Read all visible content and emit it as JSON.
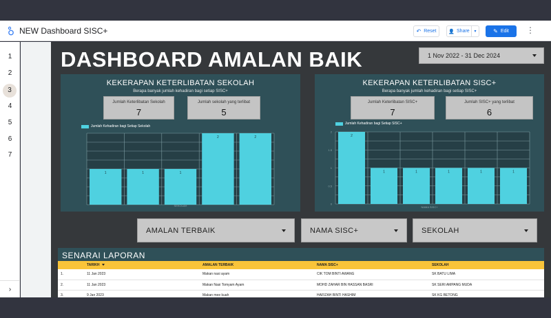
{
  "app": {
    "title": "NEW Dashboard SISC+",
    "reset_label": "Reset",
    "share_label": "Share",
    "edit_label": "Edit"
  },
  "pages": [
    "1",
    "2",
    "3",
    "4",
    "5",
    "6",
    "7"
  ],
  "active_page": "3",
  "dashboard": {
    "title": "DASHBOARD AMALAN BAIK",
    "date_range": "1 Nov 2022 - 31 Dec 2024"
  },
  "panel_left": {
    "title": "KEKERAPAN KETERLIBATAN SEKOLAH",
    "subtitle": "Berapa banyak jumlah kehadiran bagi setiap SISC+",
    "kpi1_label": "Jumlah Keterlibatan Sekolah",
    "kpi1_value": "7",
    "kpi2_label": "Jumlah sekolah yang terlibat",
    "kpi2_value": "5",
    "legend": "Jumlah Kehadiran bagi Setiap Sekolah",
    "xlabel": "SEKOLAH"
  },
  "panel_right": {
    "title": "KEKERAPAN KETERLIBATAN SISC+",
    "subtitle": "Berapa banyak jumlah kehadiran bagi setiap SISC+",
    "kpi1_label": "Jumlah Keterlibatan SISC+",
    "kpi1_value": "7",
    "kpi2_label": "Jumlah SISC+ yang terlibat",
    "kpi2_value": "6",
    "legend": "Jumlah Kehadiran bagi Setiap SISC+",
    "xlabel": "NAMA SISC+"
  },
  "filters": {
    "amalan": "AMALAN TERBAIK",
    "nama": "NAMA SISC+",
    "sekolah": "SEKOLAH"
  },
  "report": {
    "title": "SENARAI LAPORAN",
    "columns": [
      "TARIKH",
      "AMALAN TERBAIK",
      "NAMA SISC+",
      "SEKOLAH"
    ],
    "rows": [
      {
        "no": "1.",
        "tarikh": "11 Jan 2023",
        "amalan": "Makan nasi ayam",
        "nama": "CIK TOM BINTI AWANG",
        "sekolah": "SK BATU LIMA"
      },
      {
        "no": "2.",
        "tarikh": "11 Jan 2023",
        "amalan": "Makan Nasi Tomyam Ayam",
        "nama": "MOHD ZAHAR BIN HASSAN BASRI",
        "sekolah": "SK SERI AMPANG MUDA"
      },
      {
        "no": "3.",
        "tarikh": "9 Jan 2023",
        "amalan": "Makan mee kuah",
        "nama": "HAFIZAH BINTI HASHIM",
        "sekolah": "SK KG BETONG"
      }
    ]
  },
  "chart_data": [
    {
      "type": "bar",
      "title": "KEKERAPAN KETERLIBATAN SEKOLAH",
      "xlabel": "SEKOLAH",
      "series": [
        {
          "name": "Jumlah Kehadiran bagi Setiap Sekolah",
          "values": [
            1,
            1,
            1,
            2,
            2
          ]
        }
      ],
      "data_labels": [
        "1",
        "1",
        "1",
        "2",
        "2"
      ],
      "color": "#4fd1e0",
      "ylim": [
        0,
        2
      ],
      "grid": true,
      "legend": "top-left"
    },
    {
      "type": "bar",
      "title": "KEKERAPAN KETERLIBATAN SISC+",
      "xlabel": "NAMA SISC+",
      "series": [
        {
          "name": "Jumlah Kehadiran bagi Setiap SISC+",
          "values": [
            2,
            1,
            1,
            1,
            1,
            1
          ]
        }
      ],
      "data_labels": [
        "2",
        "1",
        "1",
        "1",
        "1",
        "1"
      ],
      "yticks": [
        "0",
        "0.5",
        "1",
        "1.5",
        "2"
      ],
      "color": "#4fd1e0",
      "ylim": [
        0,
        2
      ],
      "grid": true,
      "legend": "top-left"
    }
  ]
}
